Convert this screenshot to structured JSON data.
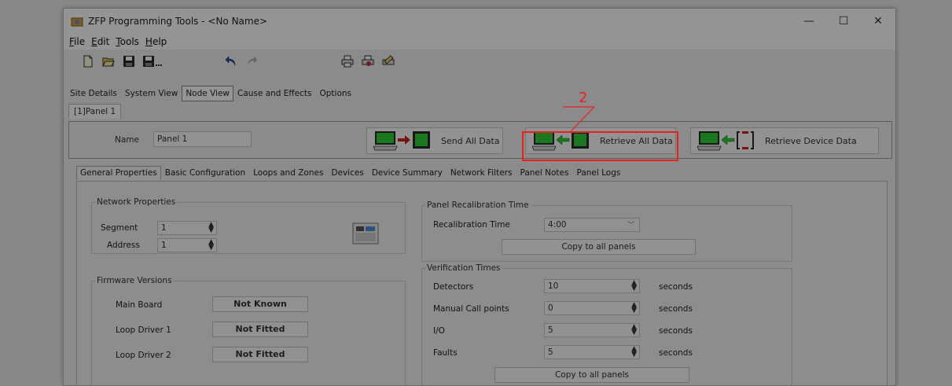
{
  "window": {
    "title": "ZFP Programming Tools - <No Name>",
    "minimize": "—",
    "maximize": "☐",
    "close": "✕"
  },
  "menu": [
    {
      "first": "F",
      "rest": "ile"
    },
    {
      "first": "E",
      "rest": "dit"
    },
    {
      "first": "T",
      "rest": "ools"
    },
    {
      "first": "H",
      "rest": "elp"
    }
  ],
  "toolbar": {
    "icons": [
      "new-file-icon",
      "open-folder-icon",
      "save-icon",
      "save-as-icon",
      "undo-icon",
      "redo-icon",
      "print-icon",
      "print-preview-icon",
      "print-setup-icon"
    ]
  },
  "main_tabs": [
    "Site Details",
    "System View",
    "Node View",
    "Cause and Effects",
    "Options"
  ],
  "active_main_tab": "Node View",
  "panel_tab": "[1]Panel 1",
  "header": {
    "name_label": "Name",
    "name_value": "Panel 1",
    "send_label": "Send All Data",
    "retrieve_label": "Retrieve All Data",
    "retrieve_device_label": "Retrieve Device Data"
  },
  "annotation": {
    "number": "2",
    "color": "#e82020"
  },
  "sub_tabs": [
    "General Properties",
    "Basic Configuration",
    "Loops and Zones",
    "Devices",
    "Device Summary",
    "Network Filters",
    "Panel Notes",
    "Panel Logs"
  ],
  "network": {
    "title": "Network Properties",
    "segment_label": "Segment",
    "segment_value": "1",
    "address_label": "Address",
    "address_value": "1"
  },
  "firmware": {
    "title": "Firmware Versions",
    "rows": [
      {
        "label": "Main Board",
        "value": "Not Known"
      },
      {
        "label": "Loop Driver 1",
        "value": "Not Fitted"
      },
      {
        "label": "Loop Driver 2",
        "value": "Not Fitted"
      }
    ]
  },
  "recalibration": {
    "title": "Panel Recalibration Time",
    "label": "Recalibration Time",
    "value": "4:00",
    "copy_label": "Copy to all panels"
  },
  "verification": {
    "title": "Verification Times",
    "rows": [
      {
        "label": "Detectors",
        "value": "10",
        "unit": "seconds"
      },
      {
        "label": "Manual Call points",
        "value": "0",
        "unit": "seconds"
      },
      {
        "label": "I/O",
        "value": "5",
        "unit": "seconds"
      },
      {
        "label": "Faults",
        "value": "5",
        "unit": "seconds"
      }
    ],
    "copy_label": "Copy to all panels"
  }
}
